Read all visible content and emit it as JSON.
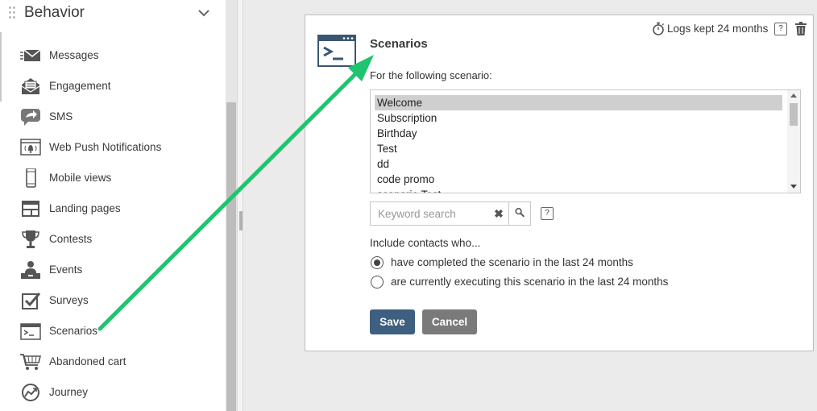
{
  "sidebar": {
    "title": "Behavior",
    "items": [
      {
        "label": "Messages",
        "icon": "envelope-icon"
      },
      {
        "label": "Engagement",
        "icon": "open-envelope-icon"
      },
      {
        "label": "SMS",
        "icon": "sms-bubble-icon"
      },
      {
        "label": "Web Push Notifications",
        "icon": "web-push-icon"
      },
      {
        "label": "Mobile views",
        "icon": "mobile-phone-icon"
      },
      {
        "label": "Landing pages",
        "icon": "landing-page-icon"
      },
      {
        "label": "Contests",
        "icon": "trophy-icon"
      },
      {
        "label": "Events",
        "icon": "event-person-icon"
      },
      {
        "label": "Surveys",
        "icon": "checkbox-icon"
      },
      {
        "label": "Scenarios",
        "icon": "terminal-icon"
      },
      {
        "label": "Abandoned cart",
        "icon": "cart-icon"
      },
      {
        "label": "Journey",
        "icon": "journey-icon"
      }
    ]
  },
  "panel": {
    "title": "Scenarios",
    "logs_text": "Logs kept 24 months",
    "help_glyph": "?",
    "scenario_label": "For the following scenario:",
    "scenarios": [
      "Welcome",
      "Subscription",
      "Birthday",
      "Test",
      "dd",
      "code promo",
      "scenario Test"
    ],
    "selected_scenario": "Welcome",
    "search_placeholder": "Keyword search",
    "clear_glyph": "✖",
    "include_label": "Include contacts who...",
    "options": [
      {
        "label": "have completed the scenario in the last 24 months",
        "checked": true
      },
      {
        "label": "are currently executing this scenario in the last 24 months",
        "checked": false
      }
    ],
    "save_label": "Save",
    "cancel_label": "Cancel"
  },
  "colors": {
    "arrow": "#1fc46e",
    "save_button": "#3e5f7f",
    "cancel_button": "#7a7a7a",
    "icon_blue": "#3a5673"
  }
}
